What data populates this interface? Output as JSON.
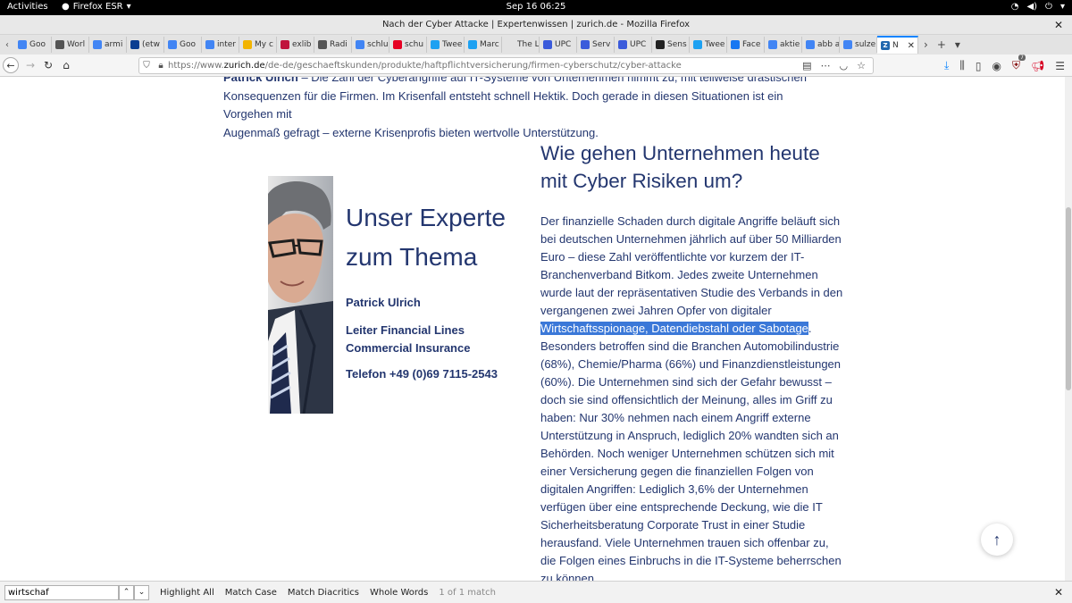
{
  "topbar": {
    "activities": "Activities",
    "app_name": "Firefox ESR",
    "clock": "Sep 16  06:25"
  },
  "window": {
    "title": "Nach der Cyber Attacke | Expertenwissen | zurich.de - Mozilla Firefox"
  },
  "tabs": [
    {
      "label": "Goo",
      "icon": "google-icon",
      "color": "#4285f4"
    },
    {
      "label": "Worl",
      "icon": "wikipedia-icon",
      "color": "#555555"
    },
    {
      "label": "armi",
      "icon": "google-icon",
      "color": "#4285f4"
    },
    {
      "label": "(etw",
      "icon": "dict-icon",
      "color": "#0a3d91"
    },
    {
      "label": "Goo",
      "icon": "translate-icon",
      "color": "#4285f4"
    },
    {
      "label": "inter",
      "icon": "google-icon",
      "color": "#4285f4"
    },
    {
      "label": "My c",
      "icon": "folder-icon",
      "color": "#f2b400"
    },
    {
      "label": "exlib",
      "icon": "exlibris-icon",
      "color": "#c0143c"
    },
    {
      "label": "Radi",
      "icon": "wikipedia-icon",
      "color": "#555555"
    },
    {
      "label": "schlu",
      "icon": "google-icon",
      "color": "#4285f4"
    },
    {
      "label": "schu",
      "icon": "pinterest-icon",
      "color": "#e60023"
    },
    {
      "label": "Twee",
      "icon": "twitter-icon",
      "color": "#1da1f2"
    },
    {
      "label": "Marc",
      "icon": "twitter-icon",
      "color": "#1da1f2"
    },
    {
      "label": "The Las",
      "icon": "blank-icon",
      "color": "#e3e3e3"
    },
    {
      "label": "UPC",
      "icon": "shield-icon",
      "color": "#3b5bdb"
    },
    {
      "label": "Serv",
      "icon": "shield-icon",
      "color": "#3b5bdb"
    },
    {
      "label": "UPC",
      "icon": "shield-icon",
      "color": "#3b5bdb"
    },
    {
      "label": "Sens",
      "icon": "grid-icon",
      "color": "#222222"
    },
    {
      "label": "Twee",
      "icon": "twitter-icon",
      "color": "#1da1f2"
    },
    {
      "label": "Face",
      "icon": "facebook-icon",
      "color": "#1877f2"
    },
    {
      "label": "aktie",
      "icon": "google-icon",
      "color": "#4285f4"
    },
    {
      "label": "abb a",
      "icon": "google-icon",
      "color": "#4285f4"
    },
    {
      "label": "sulze",
      "icon": "google-icon",
      "color": "#4285f4"
    }
  ],
  "active_tab": {
    "label": "N",
    "icon": "zurich-icon",
    "color": "#2167ae"
  },
  "url": {
    "prefix": "https://www.",
    "domain": "zurich.de",
    "path": "/de-de/geschaeftskunden/produkte/haftpflichtversicherung/firmen-cyberschutz/cyber-attacke"
  },
  "article": {
    "intro_name": "Patrick Ulrich",
    "intro_line1": " – Die Zahl der Cyberangriffe auf IT-Systeme von Unternehmen nimmt zu, mit teilweise drastischen",
    "intro_line2": "Konsequenzen für die Firmen. Im Krisenfall entsteht schnell Hektik. Doch gerade in diesen Situationen ist ein Vorgehen mit",
    "intro_line3": "Augenmaß gefragt – externe Krisenprofis bieten wertvolle Unterstützung.",
    "expert_heading_1": "Unser Experte",
    "expert_heading_2": "zum Thema",
    "expert_name": "Patrick Ulrich",
    "expert_role": "Leiter Financial Lines Commercial Insurance",
    "expert_phone": "Telefon +49 (0)69 7115-2543",
    "section_heading": "Wie gehen Unternehmen heute mit Cyber Risiken um?",
    "body_before": "Der finanzielle Schaden durch digitale Angriffe beläuft sich bei deutschen Unternehmen jährlich auf über 50 Milliarden Euro – diese Zahl veröffentlichte vor kurzem der IT-Branchenverband Bitkom. Jedes zweite Unternehmen wurde laut der repräsentativen Studie des Verbands in den vergangenen zwei Jahren Opfer von digitaler ",
    "body_highlight": "Wirtschaftsspionage, Datendiebstahl oder Sabotage",
    "body_after": ". Besonders betroffen sind die Branchen Automobilindustrie (68%), Chemie/Pharma (66%) und Finanzdienstleistungen (60%). Die Unternehmen sind sich der Gefahr bewusst – doch sie sind offensichtlich der Meinung, alles im Griff zu haben: Nur 30% nehmen nach einem Angriff externe Unterstützung in Anspruch, lediglich 20% wandten sich an Behörden. Noch weniger Unternehmen schützen sich mit einer Versicherung gegen die finanziellen Folgen von digitalen Angriffen: Lediglich 3,6% der Unternehmen verfügen über eine entsprechende Deckung, wie die IT Sicherheitsberatung Corporate Trust in einer Studie herausfand. Viele Unternehmen trauen sich offenbar zu, die Folgen eines Einbruchs in die IT-Systeme beherrschen zu können."
  },
  "findbar": {
    "query": "wirtschaf",
    "highlight_all": "Highlight All",
    "match_case": "Match Case",
    "match_diacritics": "Match Diacritics",
    "whole_words": "Whole Words",
    "status": "1 of 1 match"
  },
  "colors": {
    "brand_navy": "#23366f",
    "selection": "#3b78d8",
    "tab_accent": "#0a84ff"
  },
  "toolbar_badge": "7"
}
